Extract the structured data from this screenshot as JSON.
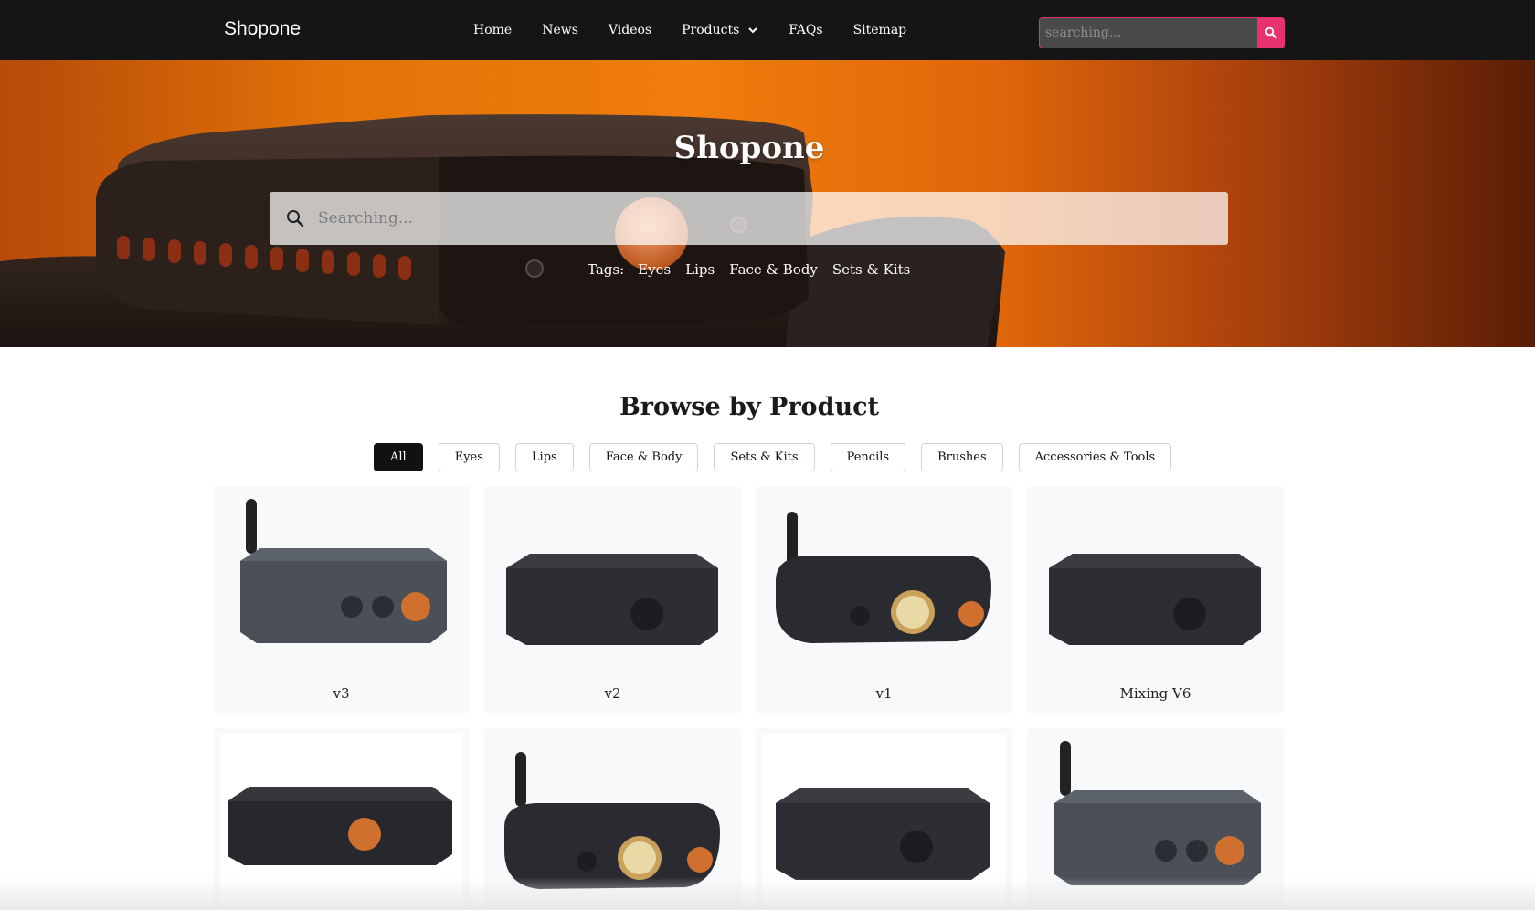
{
  "header": {
    "brand": "Shopone",
    "nav": [
      "Home",
      "News",
      "Videos",
      "Products",
      "FAQs",
      "Sitemap"
    ],
    "search_placeholder": "searching...",
    "accent_color": "#e6336e"
  },
  "hero": {
    "title": "Shopone",
    "search_placeholder": "Searching...",
    "tags_label": "Tags:",
    "tags": [
      "Eyes",
      "Lips",
      "Face & Body",
      "Sets & Kits"
    ]
  },
  "browse": {
    "title": "Browse by Product",
    "filters": [
      "All",
      "Eyes",
      "Lips",
      "Face & Body",
      "Sets & Kits",
      "Pencils",
      "Brushes",
      "Accessories & Tools"
    ],
    "active_filter": "All",
    "products": [
      {
        "name": "v3"
      },
      {
        "name": "v2"
      },
      {
        "name": "v1"
      },
      {
        "name": "Mixing V6"
      },
      {
        "name": ""
      },
      {
        "name": ""
      },
      {
        "name": ""
      },
      {
        "name": ""
      }
    ]
  }
}
